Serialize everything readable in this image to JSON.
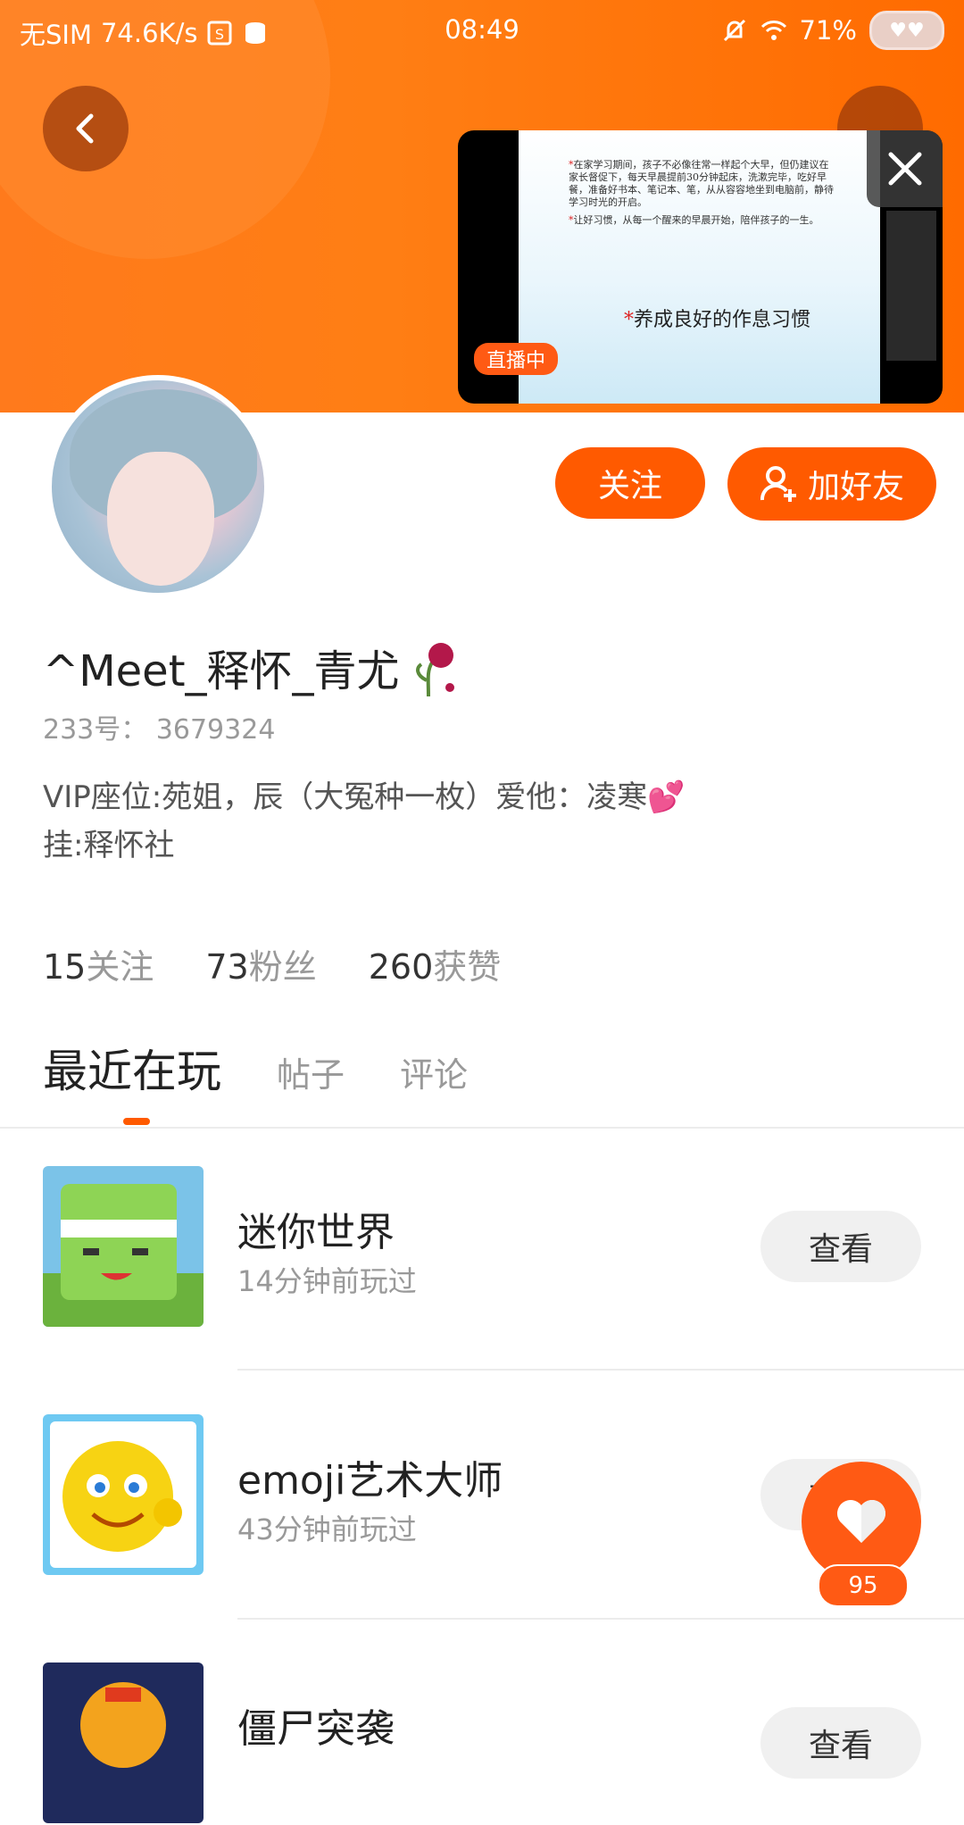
{
  "status_bar": {
    "carrier": "无SIM",
    "speed": "74.6K/s",
    "time": "08:49",
    "battery": "71%"
  },
  "live": {
    "badge": "直播中",
    "slide_para1": "在家学习期间，孩子不必像往常一样起个大早，但仍建议在家长督促下，每天早晨提前30分钟起床，洗漱完毕，吃好早餐，准备好书本、笔记本、笔，从从容容地坐到电脑前，静待学习时光的开启。",
    "slide_para2": "让好习惯，从每一个醒来的早晨开始，陪伴孩子的一生。",
    "slide_title": "养成良好的作息习惯"
  },
  "profile": {
    "follow_label": "关注",
    "add_friend_label": "加好友",
    "username": "^Meet_释怀_青尤",
    "id_text": "233号： 3679324",
    "bio_line1": "VIP座位:苑姐，辰（大冤种一枚）爱他：凌寒💕",
    "bio_line2": "挂:释怀社"
  },
  "stats": [
    {
      "num": "15",
      "label": "关注"
    },
    {
      "num": "73",
      "label": "粉丝"
    },
    {
      "num": "260",
      "label": "获赞"
    }
  ],
  "tabs": [
    "最近在玩",
    "帖子",
    "评论"
  ],
  "games": [
    {
      "name": "迷你世界",
      "played": "14分钟前玩过",
      "button": "查看"
    },
    {
      "name": "emoji艺术大师",
      "played": "43分钟前玩过",
      "button": "查看"
    },
    {
      "name": "僵尸突袭",
      "played": "",
      "button": "查看"
    }
  ],
  "like_count": "95",
  "colors": {
    "accent": "#ff5a00",
    "header": "#ff7a1c"
  }
}
